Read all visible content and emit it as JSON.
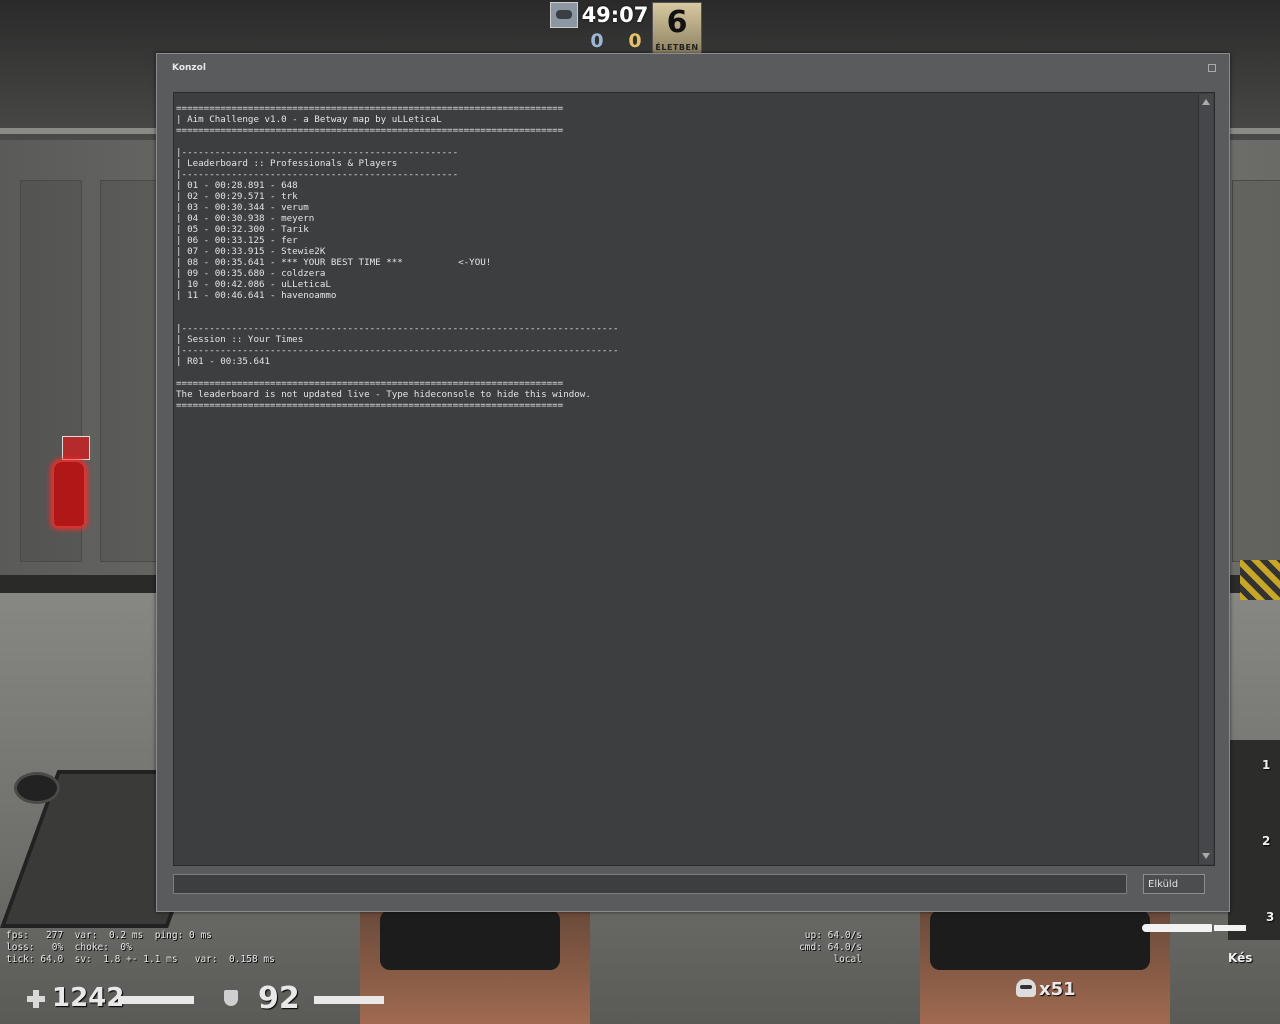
{
  "hud": {
    "timer": "49:07",
    "score_ct": "0",
    "score_t": "0",
    "round_number": "6",
    "round_label": "ÉLETBEN",
    "health": "1242",
    "armor": "92",
    "kills": "x51",
    "weapon_slots": [
      "1",
      "2",
      "3"
    ],
    "weapon_name": "Kés"
  },
  "console": {
    "title": "Konzol",
    "submit_label": "Elküld",
    "input_value": "",
    "lines": [
      "======================================================================",
      "| Aim Challenge v1.0 - a Betway map by uLLeticaL",
      "======================================================================",
      "",
      "|--------------------------------------------------",
      "| Leaderboard :: Professionals & Players",
      "|--------------------------------------------------",
      "| 01 - 00:28.891 - 648",
      "| 02 - 00:29.571 - trk",
      "| 03 - 00:30.344 - verum",
      "| 04 - 00:30.938 - meyern",
      "| 05 - 00:32.300 - Tarik",
      "| 06 - 00:33.125 - fer",
      "| 07 - 00:33.915 - Stewie2K",
      "| 08 - 00:35.641 - *** YOUR BEST TIME ***          <-YOU!",
      "| 09 - 00:35.680 - coldzera",
      "| 10 - 00:42.086 - uLLeticaL",
      "| 11 - 00:46.641 - havenoammo",
      "",
      "",
      "|-------------------------------------------------------------------------------",
      "| Session :: Your Times",
      "|-------------------------------------------------------------------------------",
      "| R01 - 00:35.641",
      "",
      "======================================================================",
      "The leaderboard is not updated live - Type hideconsole to hide this window.",
      "======================================================================"
    ]
  },
  "netgraph": {
    "left": [
      "fps:   277  var:  0.2 ms  ping: 0 ms",
      "loss:   0%  choke:  0%",
      "tick: 64.0  sv:  1.8 +- 1.1 ms   var:  0.158 ms"
    ],
    "right": [
      "up: 64.0/s",
      "cmd: 64.0/s",
      "local"
    ]
  },
  "colors": {
    "console_bg": "#595b5c",
    "console_output_bg": "#3d3e3f",
    "ct_score": "#9bb6d6",
    "t_score": "#e3c26a",
    "extinguisher_glow": "#ff2a2a"
  }
}
